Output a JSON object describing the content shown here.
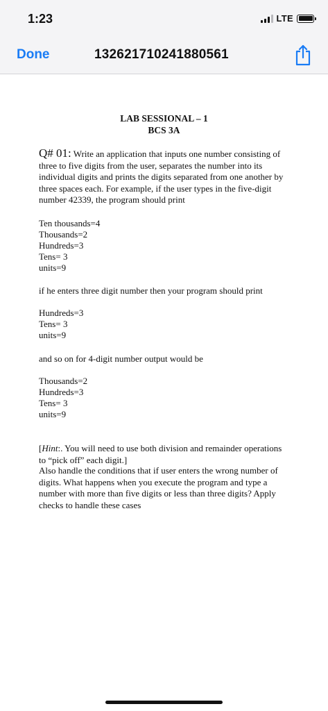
{
  "status_bar": {
    "time": "1:23",
    "network": "LTE"
  },
  "nav": {
    "done_label": "Done",
    "title": "13262171024188056​1",
    "share_icon": "share-icon"
  },
  "document": {
    "heading_line1": "LAB SESSIONAL – 1",
    "heading_line2": "BCS 3A",
    "question_label": "Q# 01:",
    "question_text": " Write an application that inputs one number consisting of three to five digits from the user, separates the number into its individual digits and prints the digits separated from one another by three spaces each. For example, if the user types in the five-digit number 42339, the program should print",
    "example1": [
      "Ten thousands=4",
      "Thousands=2",
      "Hundreds=3",
      "Tens= 3",
      "units=9"
    ],
    "three_digit_intro": "if he enters three digit number then your program should print",
    "example2": [
      "Hundreds=3",
      "Tens= 3",
      "units=9"
    ],
    "four_digit_intro": "and so on for 4-digit number output would be",
    "example3": [
      "Thousands=2",
      "Hundreds=3",
      "Tens= 3",
      "units=9"
    ],
    "hint_open": "[",
    "hint_label": "Hint",
    "hint_text": ":. You will need to use both division and remainder operations to “pick off” each digit.]",
    "final_text": "Also handle the conditions that if user enters the wrong number of digits. What happens when you execute the program and type a number with more than five digits or less than three digits? Apply checks to handle these cases"
  },
  "colors": {
    "accent": "#1a7cf5",
    "chrome_bg": "#f4f4f6"
  }
}
